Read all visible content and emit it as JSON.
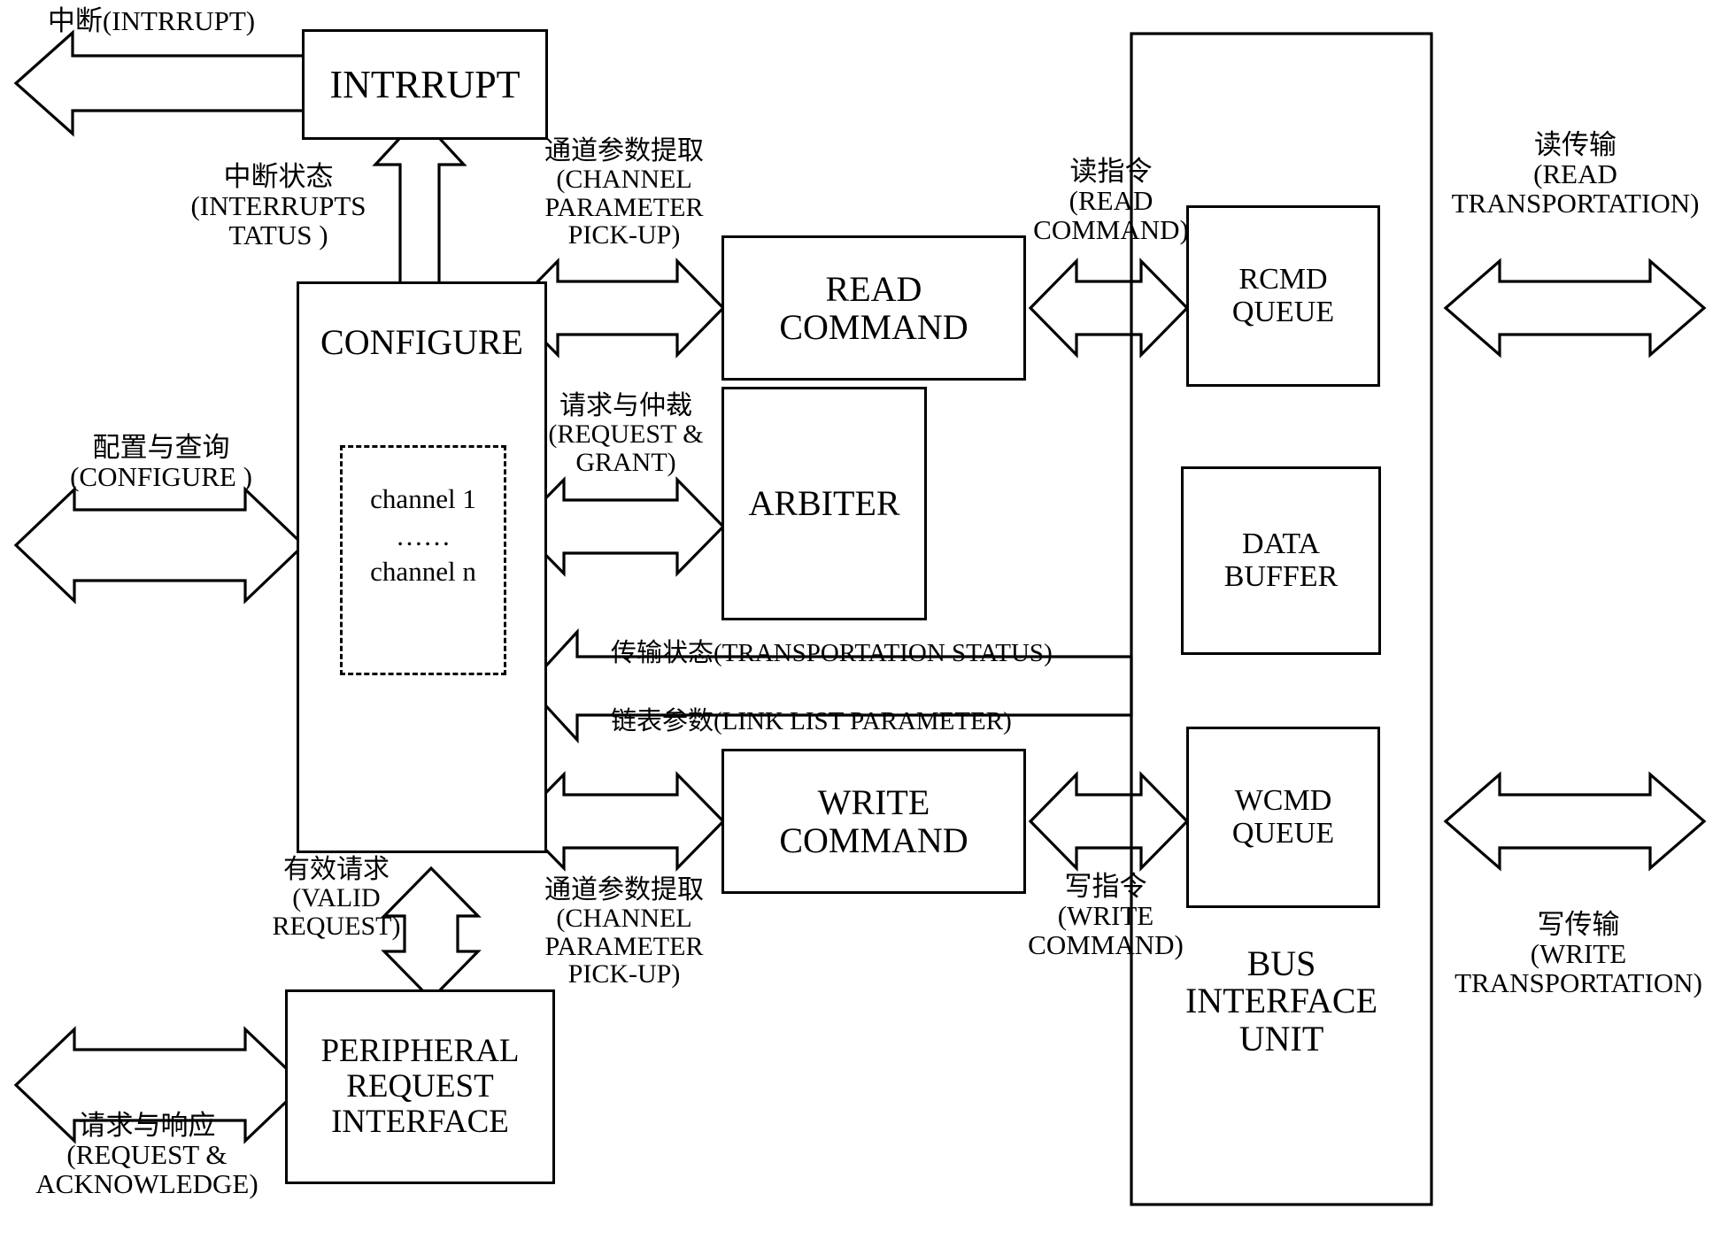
{
  "diagram": {
    "title": "DMA controller block diagram",
    "stroke_color": "#000000",
    "background_color": "#ffffff"
  },
  "blocks": {
    "intrrupt": {
      "label": "INTRRUPT"
    },
    "configure": {
      "label": "CONFIGURE",
      "channel_first": "channel 1",
      "channel_ellipsis": "……",
      "channel_last": "channel n"
    },
    "read_command": {
      "label": "READ\nCOMMAND"
    },
    "arbiter": {
      "label": "ARBITER"
    },
    "write_command": {
      "label": "WRITE\nCOMMAND"
    },
    "peripheral_request_interface": {
      "label": "PERIPHERAL\nREQUEST\nINTERFACE"
    },
    "rcmd_queue": {
      "label": "RCMD\nQUEUE"
    },
    "data_buffer": {
      "label": "DATA\nBUFFER"
    },
    "wcmd_queue": {
      "label": "WCMD\nQUEUE"
    },
    "bus_interface_unit": {
      "label": "BUS\nINTERFACE\nUNIT"
    }
  },
  "labels": {
    "interrupt_out": "中断(INTRRUPT)",
    "interrupt_status": "中断状态\n(INTERRUPTS\nTATUS )",
    "channel_param_pickup_read": "通道参数提取\n(CHANNEL\nPARAMETER\nPICK-UP)",
    "read_command_link": "读指令\n(READ\nCOMMAND)",
    "read_transportation": "读传输\n(READ\nTRANSPORTATION)",
    "configure_query": "配置与查询\n(CONFIGURE )",
    "request_and_grant": "请求与仲裁\n(REQUEST &\nGRANT)",
    "transportation_status": "传输状态(TRANSPORTATION STATUS)",
    "link_list_parameter": "链表参数(LINK LIST PARAMETER)",
    "valid_request": "有效请求\n(VALID\nREQUEST)",
    "channel_param_pickup_write": "通道参数提取\n(CHANNEL\nPARAMETER\nPICK-UP)",
    "write_command_link": "写指令\n(WRITE\nCOMMAND)",
    "write_transportation": "写传输\n(WRITE\nTRANSPORTATION)",
    "request_acknowledge": "请求与响应\n(REQUEST &\nACKNOWLEDGE)"
  }
}
